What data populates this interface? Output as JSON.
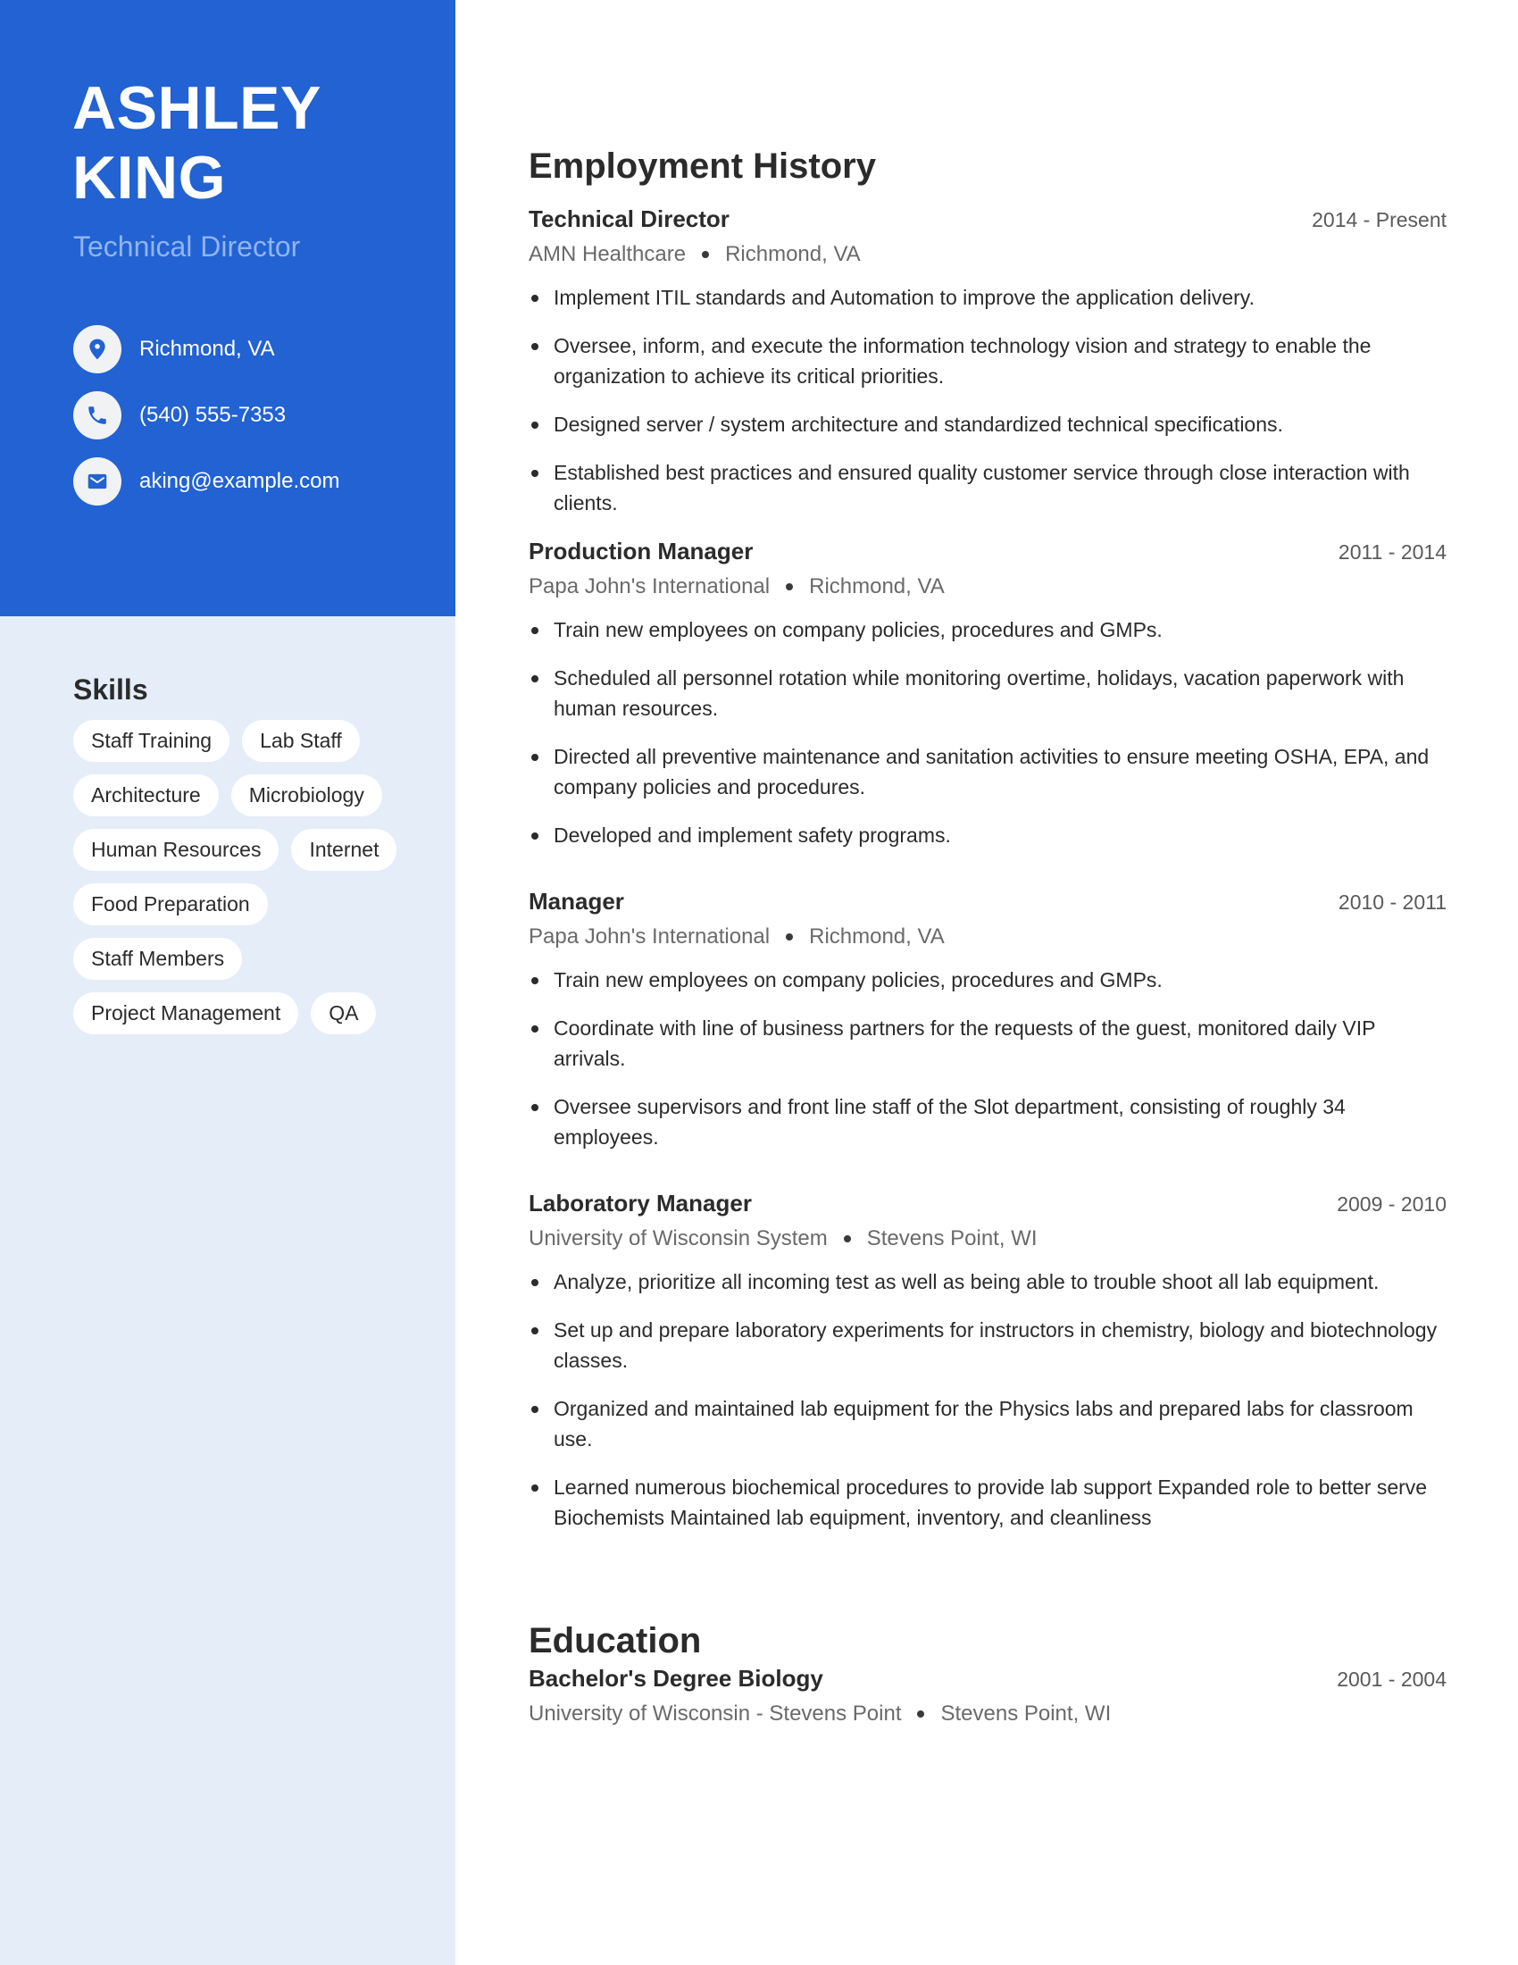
{
  "profile": {
    "first_name": "ASHLEY",
    "last_name": "KING",
    "title": "Technical Director"
  },
  "contact": [
    {
      "icon": "location-pin-icon",
      "value": "Richmond, VA"
    },
    {
      "icon": "phone-icon",
      "value": "(540) 555-7353"
    },
    {
      "icon": "email-icon",
      "value": "aking@example.com"
    }
  ],
  "skills": {
    "title": "Skills",
    "items": [
      "Staff Training",
      "Lab Staff",
      "Architecture",
      "Microbiology",
      "Human Resources",
      "Internet",
      "Food Preparation",
      "Staff Members",
      "Project Management",
      "QA"
    ]
  },
  "employment": {
    "title": "Employment History",
    "jobs": [
      {
        "title": "Technical Director",
        "dates": "2014 - Present",
        "company": "AMN Healthcare",
        "location": "Richmond, VA",
        "bullets": [
          "Implement ITIL standards and Automation to improve the application delivery.",
          "Oversee, inform, and execute the information technology vision and strategy to enable the organization to achieve its critical priorities.",
          "Designed server / system architecture and standardized technical specifications.",
          "Established best practices and ensured quality customer service through close interaction with clients."
        ]
      },
      {
        "title": "Production Manager",
        "dates": "2011 - 2014",
        "company": "Papa John's International",
        "location": "Richmond, VA",
        "bullets": [
          "Train new employees on company policies, procedures and GMPs.",
          "Scheduled all personnel rotation while monitoring overtime, holidays, vacation paperwork with human resources.",
          "Directed all preventive maintenance and sanitation activities to ensure meeting OSHA, EPA, and company policies and procedures.",
          "Developed and implement safety programs."
        ]
      },
      {
        "title": "Manager",
        "dates": "2010 - 2011",
        "company": "Papa John's International",
        "location": "Richmond, VA",
        "bullets": [
          "Train new employees on company policies, procedures and GMPs.",
          "Coordinate with line of business partners for the requests of the guest, monitored daily VIP arrivals.",
          "Oversee supervisors and front line staff of the Slot department, consisting of roughly 34 employees."
        ]
      },
      {
        "title": "Laboratory Manager",
        "dates": "2009 - 2010",
        "company": "University of Wisconsin System",
        "location": "Stevens Point, WI",
        "bullets": [
          "Analyze, prioritize all incoming test as well as being able to trouble shoot all lab equipment.",
          "Set up and prepare laboratory experiments for instructors in chemistry, biology and biotechnology classes.",
          "Organized and maintained lab equipment for the Physics labs and prepared labs for classroom use.",
          "Learned numerous biochemical procedures to provide lab support Expanded role to better serve Biochemists Maintained lab equipment, inventory, and cleanliness"
        ]
      }
    ]
  },
  "education": {
    "title": "Education",
    "entries": [
      {
        "degree": "Bachelor's Degree Biology",
        "dates": "2001 - 2004",
        "school": "University of Wisconsin - Stevens Point",
        "location": "Stevens Point, WI"
      }
    ]
  },
  "colors": {
    "accent": "#2262d2",
    "sidebar_bg": "#e5edf9",
    "subtitle": "#8fb4f0",
    "text": "#2b2b2b",
    "muted": "#6a6a6a"
  }
}
